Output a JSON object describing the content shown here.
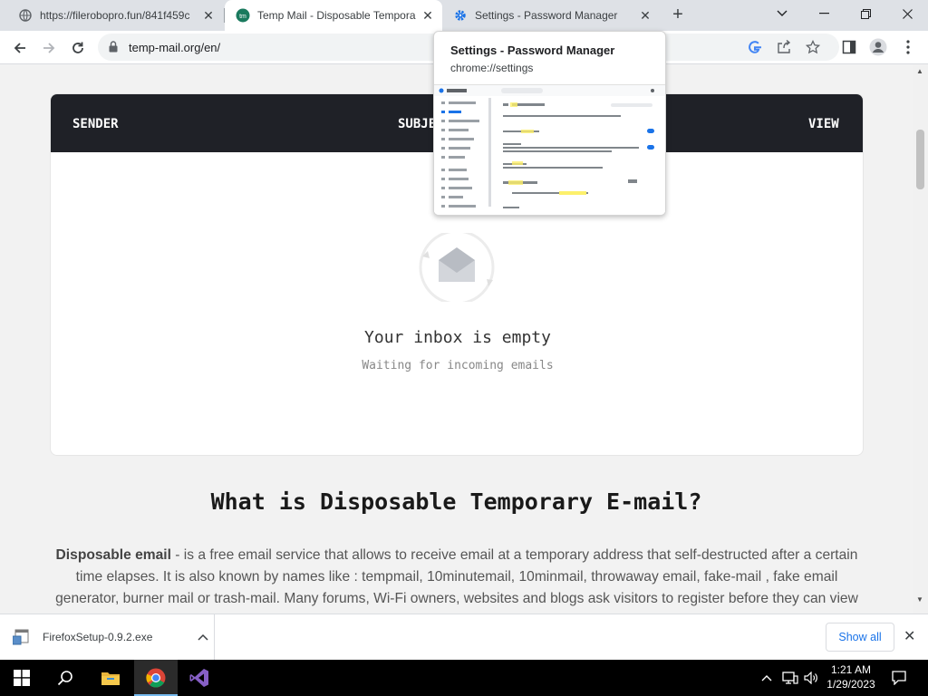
{
  "browser": {
    "tabs": [
      {
        "title": "https://filerobopro.fun/841f459c",
        "active": false
      },
      {
        "title": "Temp Mail - Disposable Tempora",
        "active": true
      },
      {
        "title": "Settings - Password Manager",
        "active": false
      }
    ],
    "url": "temp-mail.org/en/"
  },
  "hover_card": {
    "title": "Settings - Password Manager",
    "url": "chrome://settings"
  },
  "inbox": {
    "columns": [
      "SENDER",
      "SUBJE",
      "VIEW"
    ],
    "empty_title": "Your inbox is empty",
    "empty_subtitle": "Waiting for incoming emails"
  },
  "content": {
    "heading": "What is Disposable Temporary E-mail?",
    "intro_bold": "Disposable email",
    "intro_line1": " - is a free email service that allows to receive email at a temporary address that self-destructed after a certain",
    "intro_line2": "time elapses. It is also known by names like : tempmail, 10minutemail, 10minmail, throwaway email, fake-mail , fake email",
    "intro_line3": "generator, burner mail or trash-mail. Many forums, Wi-Fi owners, websites and blogs ask visitors to register before they can view"
  },
  "downloads": {
    "file": "FirefoxSetup-0.9.2.exe",
    "show_all": "Show all"
  },
  "taskbar": {
    "time": "1:21 AM",
    "date": "1/29/2023"
  },
  "colors": {
    "inbox_header_bg": "#1f2127",
    "accent_blue": "#1a73e8",
    "taskbar_bg": "#000000"
  }
}
